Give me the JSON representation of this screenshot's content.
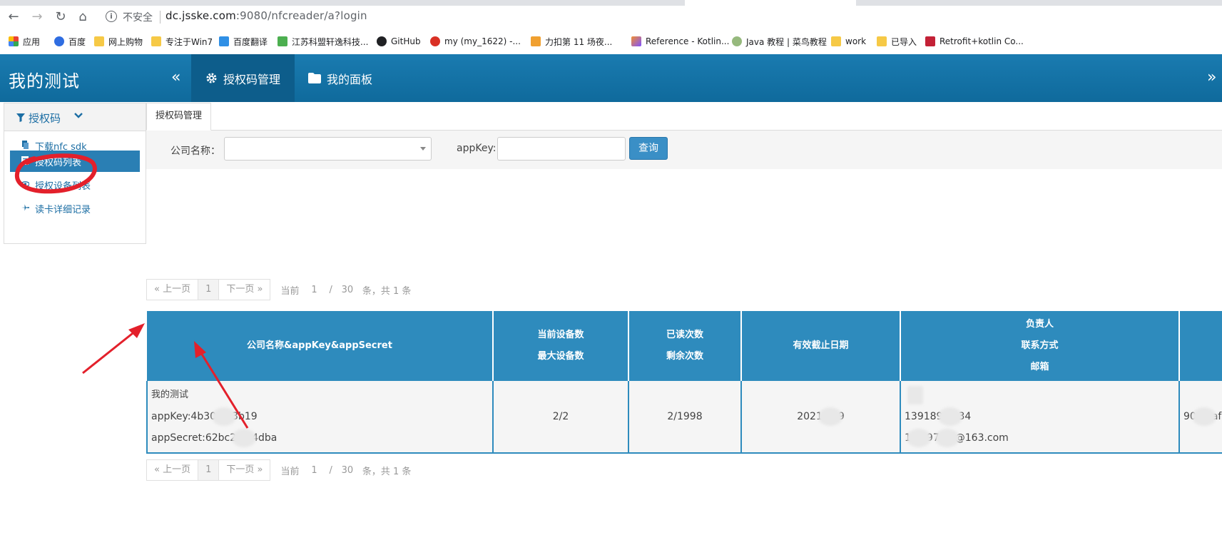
{
  "browser": {
    "nav": {
      "back": "←",
      "forward": "→",
      "reload": "↻",
      "home": "⌂"
    },
    "url_info_icon": "i",
    "security_label": "不安全",
    "url_host": "dc.jsske.com",
    "url_rest": ":9080/nfcreader/a?login",
    "bookmarks": [
      {
        "label": "应用",
        "icon": "apps-grid-icon",
        "color": "#e94235"
      },
      {
        "label": "百度",
        "icon": "baidu-paw-icon",
        "color": "#2f6de1"
      },
      {
        "label": "网上购物",
        "icon": "folder-icon",
        "color": "#f6c946"
      },
      {
        "label": "专注于Win7",
        "icon": "folder-icon",
        "color": "#f6c946"
      },
      {
        "label": "百度翻译",
        "icon": "translate-icon",
        "color": "#2f8fe5"
      },
      {
        "label": "江苏科盟轩逸科技...",
        "icon": "company-icon",
        "color": "#4caf50"
      },
      {
        "label": "GitHub",
        "icon": "github-icon",
        "color": "#202124"
      },
      {
        "label": "my (my_1622) -...",
        "icon": "g-icon",
        "color": "#d93025"
      },
      {
        "label": "力扣第 11 场夜...",
        "icon": "leetcode-icon",
        "color": "#f0a030"
      },
      {
        "label": "Reference - Kotlin...",
        "icon": "kotlin-icon",
        "color": "#7f52ff"
      },
      {
        "label": "Java 教程 | 菜鸟教程",
        "icon": "runoob-icon",
        "color": "#96b97d"
      },
      {
        "label": "work",
        "icon": "folder-icon",
        "color": "#f6c946"
      },
      {
        "label": "已导入",
        "icon": "folder-icon",
        "color": "#f6c946"
      },
      {
        "label": "Retrofit+kotlin Co...",
        "icon": "csdn-icon",
        "color": "#c32136"
      }
    ]
  },
  "header": {
    "title": "我的测试",
    "collapse_left": "«",
    "collapse_right": "»",
    "nav": [
      {
        "label": "授权码管理",
        "icon": "gear-icon",
        "active": true
      },
      {
        "label": "我的面板",
        "icon": "folder-icon",
        "active": false
      }
    ]
  },
  "sidebar": {
    "section_label": "授权码",
    "section_icon": "filter-icon",
    "items": [
      {
        "label": "下载nfc sdk",
        "icon": "download-icon",
        "active": false
      },
      {
        "label": "授权码列表",
        "icon": "list-icon",
        "active": true
      },
      {
        "label": "授权设备列表",
        "icon": "eye-icon",
        "active": false
      },
      {
        "label": "读卡详细记录",
        "icon": "plane-icon",
        "active": false
      }
    ]
  },
  "main": {
    "tab_label": "授权码管理",
    "search": {
      "company_label": "公司名称：",
      "company_value": "",
      "appkey_label": "appKey:",
      "appkey_value": "",
      "query_label": "查询"
    },
    "pager": {
      "prev": "« 上一页",
      "page": "1",
      "next": "下一页 »",
      "current_label": "当前",
      "current_value": "1",
      "slash": "/",
      "per_page": "30",
      "total_label": "条，共 1 条"
    },
    "table": {
      "headers": [
        {
          "lines": [
            "公司名称&appKey&appSecret"
          ]
        },
        {
          "lines": [
            "当前设备数",
            "最大设备数"
          ]
        },
        {
          "lines": [
            "已读次数",
            "剩余次数"
          ]
        },
        {
          "lines": [
            "有效截止日期"
          ]
        },
        {
          "lines": [
            "负责人",
            "联系方式",
            "邮箱"
          ]
        },
        {
          "lines": [
            ""
          ]
        }
      ],
      "rows": [
        {
          "company": "我的测试",
          "appkey_prefix": "appKey:4b30",
          "appkey_suffix": "3b19",
          "secret_prefix": "appSecret:62bc2",
          "secret_suffix": "4dba",
          "devices": "2/2",
          "reads": "2/1998",
          "expiry_prefix": "2021",
          "expiry_suffix": "9",
          "contact_name": "",
          "phone_prefix": "139189",
          "phone_suffix": "34",
          "email_prefix": "1",
          "email_mid": "97",
          "email_suffix": "@163.com",
          "extra_prefix": "90",
          "extra_suffix": "afa"
        }
      ]
    }
  },
  "annotations": {
    "circle_color": "#e3202b",
    "arrow_color": "#e3202b"
  }
}
